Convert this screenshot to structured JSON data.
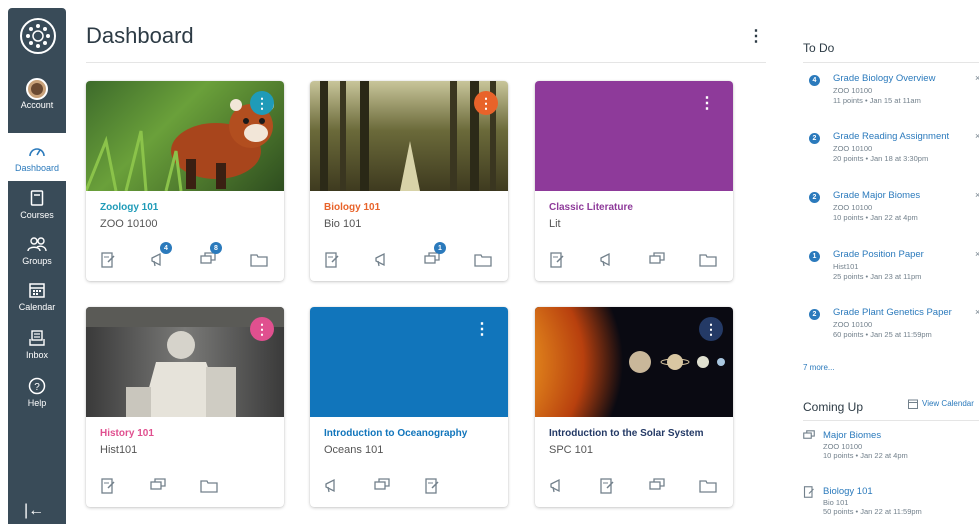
{
  "header": {
    "title": "Dashboard"
  },
  "nav": {
    "items": [
      {
        "label": "Account",
        "icon": "user-avatar"
      },
      {
        "label": "Dashboard",
        "icon": "dashboard-icon"
      },
      {
        "label": "Courses",
        "icon": "book-icon"
      },
      {
        "label": "Groups",
        "icon": "groups-icon"
      },
      {
        "label": "Calendar",
        "icon": "calendar-icon"
      },
      {
        "label": "Inbox",
        "icon": "inbox-icon"
      },
      {
        "label": "Help",
        "icon": "help-icon"
      }
    ],
    "collapse_icon": "|←"
  },
  "cards": [
    {
      "name": "Zoology 101",
      "code": "ZOO 10100",
      "color": "#1f9bb8",
      "badges": [
        "",
        "4",
        "8",
        ""
      ]
    },
    {
      "name": "Biology 101",
      "code": "Bio 101",
      "color": "#e8632a",
      "badges": [
        "",
        "",
        "1",
        ""
      ]
    },
    {
      "name": "Classic Literature",
      "code": "Lit",
      "color": "#8e3a9a",
      "badges": [
        "",
        "",
        "",
        ""
      ]
    },
    {
      "name": "History 101",
      "code": "Hist101",
      "color": "#e0508f",
      "badges": [
        "",
        "",
        ""
      ]
    },
    {
      "name": "Introduction to Oceanography",
      "code": "Oceans 101",
      "color": "#1175bb",
      "badges": [
        "",
        "",
        ""
      ]
    },
    {
      "name": "Introduction to the Solar System",
      "code": "SPC 101",
      "color": "#243a66",
      "badges": [
        "",
        "",
        "",
        ""
      ]
    }
  ],
  "todo": {
    "heading": "To Do",
    "items": [
      {
        "num": "4",
        "title": "Grade Biology Overview",
        "course": "ZOO 10100",
        "meta": "11 points • Jan 15 at 11am"
      },
      {
        "num": "2",
        "title": "Grade Reading Assignment",
        "course": "ZOO 10100",
        "meta": "20 points • Jan 18 at 3:30pm"
      },
      {
        "num": "2",
        "title": "Grade Major Biomes",
        "course": "ZOO 10100",
        "meta": "10 points • Jan 22 at 4pm"
      },
      {
        "num": "1",
        "title": "Grade Position Paper",
        "course": "Hist101",
        "meta": "25 points • Jan 23 at 11pm"
      },
      {
        "num": "2",
        "title": "Grade Plant Genetics Paper",
        "course": "ZOO 10100",
        "meta": "60 points • Jan 25 at 11:59pm"
      }
    ],
    "more": "7 more..."
  },
  "coming_up": {
    "heading": "Coming Up",
    "view_calendar": "View Calendar",
    "items": [
      {
        "title": "Major Biomes",
        "course": "ZOO 10100",
        "meta": "10 points • Jan 22 at 4pm"
      },
      {
        "title": "Biology 101",
        "course": "Bio 101",
        "meta": "50 points • Jan 22 at 11:59pm"
      }
    ]
  }
}
